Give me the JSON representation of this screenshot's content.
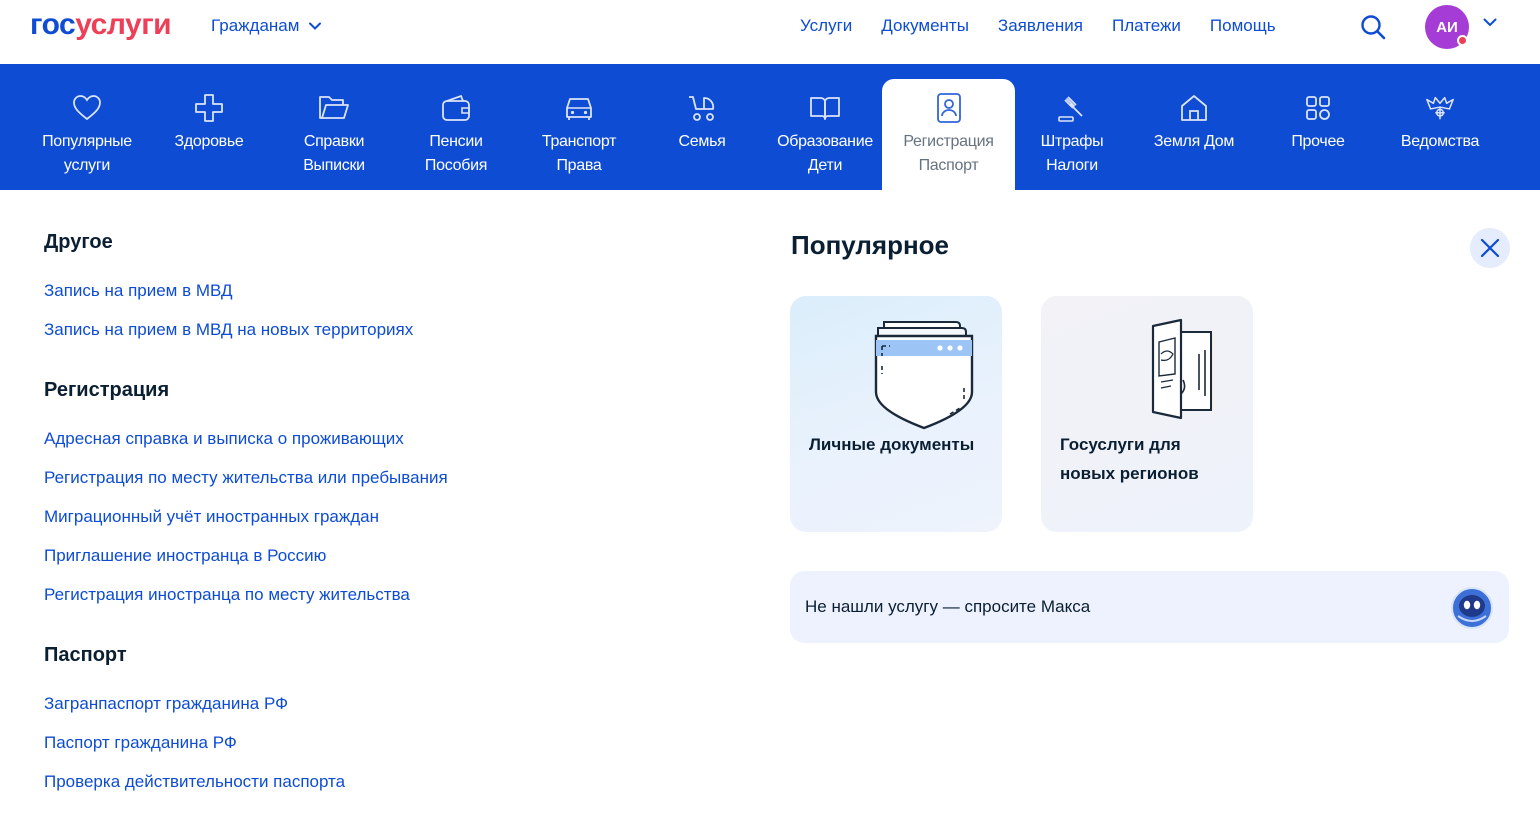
{
  "header": {
    "logo_part1": "гос",
    "logo_part2": "услуги",
    "audience": "Гражданам",
    "nav": [
      "Услуги",
      "Документы",
      "Заявления",
      "Платежи",
      "Помощь"
    ],
    "avatar_initials": "АИ"
  },
  "categories": [
    {
      "label": "Популярные\nуслуги",
      "icon": "heart-icon"
    },
    {
      "label": "Здоровье",
      "icon": "medical-cross-icon"
    },
    {
      "label": "Справки\nВыписки",
      "icon": "folder-icon"
    },
    {
      "label": "Пенсии\nПособия",
      "icon": "wallet-icon"
    },
    {
      "label": "Транспорт\nПрава",
      "icon": "car-icon"
    },
    {
      "label": "Семья",
      "icon": "stroller-icon"
    },
    {
      "label": "Образование\nДети",
      "icon": "book-icon"
    },
    {
      "label": "Регистрация\nПаспорт",
      "icon": "passport-icon",
      "active": true
    },
    {
      "label": "Штрафы\nНалоги",
      "icon": "gavel-icon"
    },
    {
      "label": "Земля Дом",
      "icon": "house-icon"
    },
    {
      "label": "Прочее",
      "icon": "grid-icon"
    },
    {
      "label": "Ведомства",
      "icon": "emblem-icon"
    }
  ],
  "groups": [
    {
      "title": "Другое",
      "links": [
        "Запись на прием в МВД",
        "Запись на прием в МВД на новых территориях"
      ]
    },
    {
      "title": "Регистрация",
      "links": [
        "Адресная справка и выписка о проживающих",
        "Регистрация по месту жительства или пребывания",
        "Миграционный учёт иностранных граждан",
        "Приглашение иностранца в Россию",
        "Регистрация иностранца по месту жительства"
      ]
    },
    {
      "title": "Паспорт",
      "links": [
        "Загранпаспорт гражданина РФ",
        "Паспорт гражданина РФ",
        "Проверка действительности паспорта"
      ]
    }
  ],
  "popular": {
    "title": "Популярное",
    "cards": [
      {
        "title": "Личные документы",
        "icon": "document-pocket-icon"
      },
      {
        "title": "Госуслуги для новых регионов",
        "icon": "open-door-passport-icon"
      }
    ],
    "ask": "Не нашли услугу — спросите Макса"
  },
  "colors": {
    "brand_blue": "#0d4cd3",
    "brand_red": "#ee3f58",
    "avatar": "#a53cd6"
  }
}
